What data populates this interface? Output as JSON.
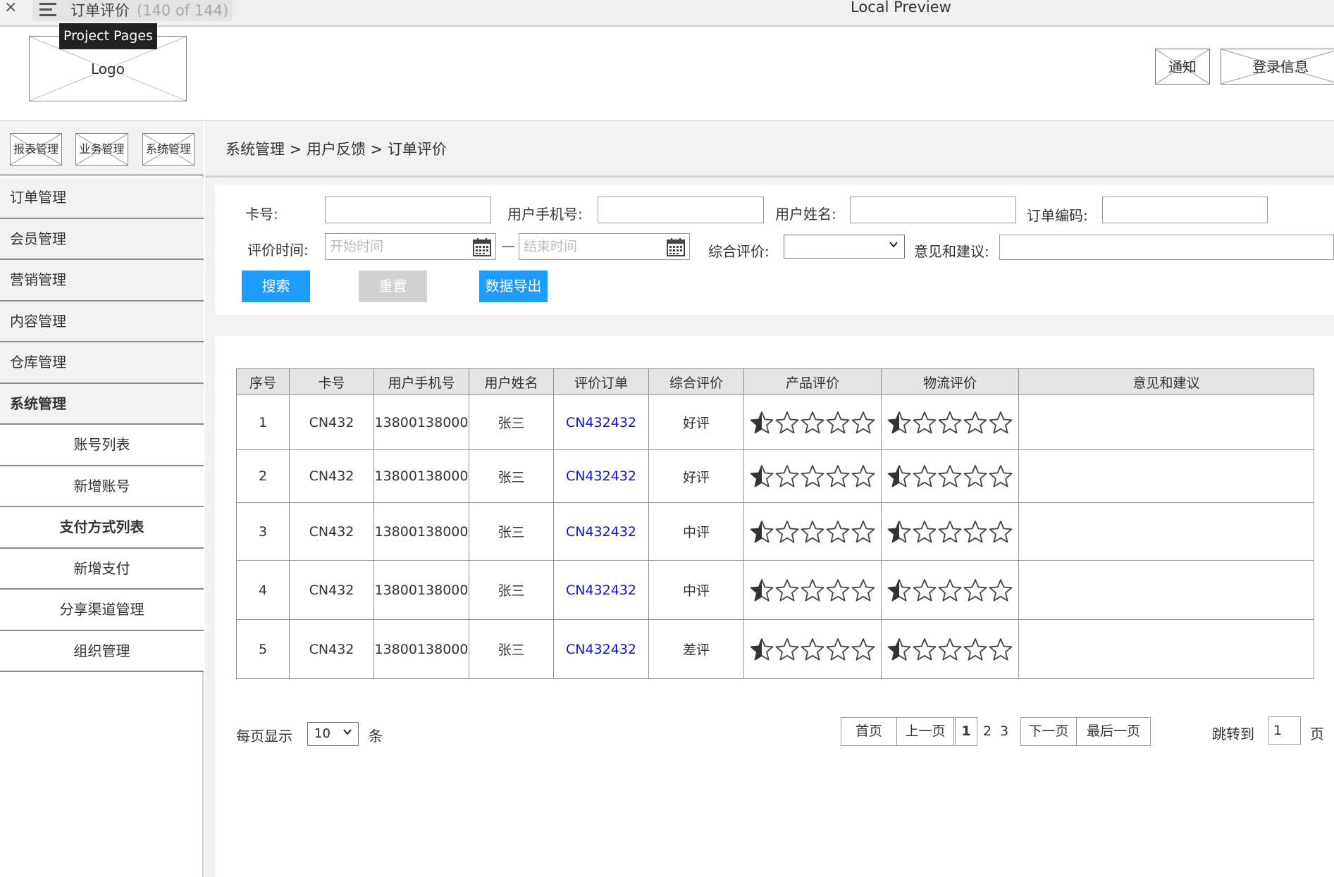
{
  "preview_bar": {
    "page_title": "订单评价",
    "page_count": "(140 of 144)",
    "app_title": "Local Preview",
    "tooltip": "Project Pages"
  },
  "header": {
    "logo": "Logo",
    "notice_button": "通知",
    "login_button": "登录信息"
  },
  "sidebar": {
    "top_buttons": [
      "报表管理",
      "业务管理",
      "系统管理"
    ],
    "menu": [
      {
        "label": "订单管理",
        "type": "group",
        "active": false
      },
      {
        "label": "会员管理",
        "type": "group",
        "active": false
      },
      {
        "label": "营销管理",
        "type": "group",
        "active": false
      },
      {
        "label": "内容管理",
        "type": "group",
        "active": false
      },
      {
        "label": "仓库管理",
        "type": "group",
        "active": false
      },
      {
        "label": "系统管理",
        "type": "group",
        "active": true
      },
      {
        "label": "账号列表",
        "type": "sub",
        "active": false
      },
      {
        "label": "新增账号",
        "type": "sub",
        "active": false
      },
      {
        "label": "支付方式列表",
        "type": "sub",
        "active": true
      },
      {
        "label": "新增支付",
        "type": "sub",
        "active": false
      },
      {
        "label": "分享渠道管理",
        "type": "sub",
        "active": false
      },
      {
        "label": "组织管理",
        "type": "sub",
        "active": false
      }
    ]
  },
  "breadcrumb": "系统管理 > 用户反馈 > 订单评价",
  "filters": {
    "card_label": "卡号:",
    "phone_label": "用户手机号:",
    "name_label": "用户姓名:",
    "order_label": "订单编码:",
    "time_label": "评价时间:",
    "start_placeholder": "开始时间",
    "dash": "—",
    "end_placeholder": "结束时间",
    "rating_label": "综合评价:",
    "suggest_label": "意见和建议:",
    "search_button": "搜索",
    "reset_button": "重置",
    "export_button": "数据导出"
  },
  "table": {
    "headers": [
      "序号",
      "卡号",
      "用户手机号",
      "用户姓名",
      "评价订单",
      "综合评价",
      "产品评价",
      "物流评价",
      "意见和建议"
    ],
    "rows": [
      {
        "no": "1",
        "card": "CN432",
        "phone": "13800138000",
        "name": "张三",
        "order": "CN432432",
        "overall": "好评",
        "product_rating": 0.5,
        "logistics_rating": 0.5,
        "suggestion": ""
      },
      {
        "no": "2",
        "card": "CN432",
        "phone": "13800138000",
        "name": "张三",
        "order": "CN432432",
        "overall": "好评",
        "product_rating": 0.5,
        "logistics_rating": 0.5,
        "suggestion": ""
      },
      {
        "no": "3",
        "card": "CN432",
        "phone": "13800138000",
        "name": "张三",
        "order": "CN432432",
        "overall": "中评",
        "product_rating": 0.5,
        "logistics_rating": 0.5,
        "suggestion": ""
      },
      {
        "no": "4",
        "card": "CN432",
        "phone": "13800138000",
        "name": "张三",
        "order": "CN432432",
        "overall": "中评",
        "product_rating": 0.5,
        "logistics_rating": 0.5,
        "suggestion": ""
      },
      {
        "no": "5",
        "card": "CN432",
        "phone": "13800138000",
        "name": "张三",
        "order": "CN432432",
        "overall": "差评",
        "product_rating": 0.5,
        "logistics_rating": 0.5,
        "suggestion": ""
      }
    ],
    "max_stars": 5
  },
  "pagination": {
    "per_page_label": "每页显示",
    "per_page_value": "10",
    "per_page_unit": "条",
    "first": "首页",
    "prev": "上一页",
    "pages": [
      "1",
      "2",
      "3"
    ],
    "current_page": "1",
    "next": "下一页",
    "last": "最后一页",
    "jump_label": "跳转到",
    "jump_value": "1",
    "jump_unit": "页"
  },
  "colors": {
    "primary_button": "#1e9bff",
    "secondary_button": "#d0d0d0",
    "link": "#1212d6"
  }
}
